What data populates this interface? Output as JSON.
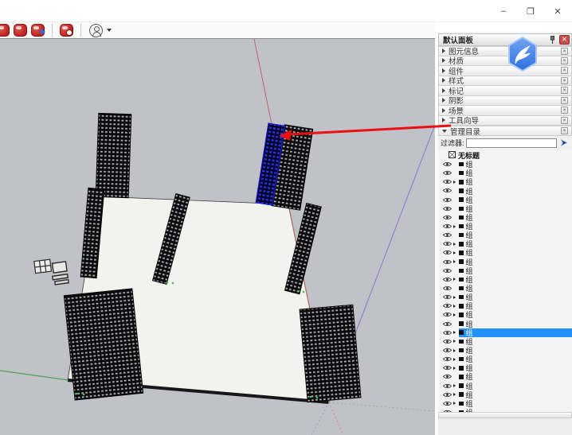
{
  "window": {
    "controls": {
      "minimize": "–",
      "maximize": "❐",
      "close": "✕"
    }
  },
  "toolbar": {
    "icons": [
      {
        "name": "plugin-red-icon-1"
      },
      {
        "name": "plugin-red-icon-2"
      },
      {
        "name": "plugin-export-icon"
      },
      {
        "name": "plugin-tag-icon"
      },
      {
        "name": "account-avatar"
      }
    ]
  },
  "panel": {
    "title": "默认面板",
    "sections": [
      {
        "label": "图元信息"
      },
      {
        "label": "材质"
      },
      {
        "label": "组件"
      },
      {
        "label": "样式"
      },
      {
        "label": "标记"
      },
      {
        "label": "阴影"
      },
      {
        "label": "场景"
      },
      {
        "label": "工具向导"
      }
    ],
    "close_glyph": "✕",
    "section_close_glyph": "×",
    "outliner": {
      "label": "管理目录",
      "filter_label": "过滤器:",
      "filter_value": "",
      "root_label": "无标题",
      "group_label": "组",
      "rows": [
        {
          "arrow": false,
          "selected": false
        },
        {
          "arrow": false,
          "selected": false
        },
        {
          "arrow": true,
          "selected": false
        },
        {
          "arrow": false,
          "selected": false
        },
        {
          "arrow": false,
          "selected": false
        },
        {
          "arrow": false,
          "selected": false
        },
        {
          "arrow": false,
          "selected": false
        },
        {
          "arrow": true,
          "selected": false
        },
        {
          "arrow": false,
          "selected": false
        },
        {
          "arrow": true,
          "selected": false
        },
        {
          "arrow": true,
          "selected": false
        },
        {
          "arrow": true,
          "selected": false
        },
        {
          "arrow": false,
          "selected": false
        },
        {
          "arrow": true,
          "selected": false
        },
        {
          "arrow": false,
          "selected": false
        },
        {
          "arrow": true,
          "selected": false
        },
        {
          "arrow": true,
          "selected": false
        },
        {
          "arrow": true,
          "selected": false
        },
        {
          "arrow": false,
          "selected": false
        },
        {
          "arrow": true,
          "selected": true
        },
        {
          "arrow": true,
          "selected": false
        },
        {
          "arrow": true,
          "selected": false
        },
        {
          "arrow": true,
          "selected": false
        },
        {
          "arrow": true,
          "selected": false
        },
        {
          "arrow": false,
          "selected": false
        },
        {
          "arrow": true,
          "selected": false
        },
        {
          "arrow": true,
          "selected": false
        },
        {
          "arrow": true,
          "selected": false
        },
        {
          "arrow": false,
          "selected": false
        }
      ]
    }
  },
  "colors": {
    "selection_blue": "#2191fb",
    "geometry_selected_blue": "#2330ee",
    "annotation_red": "#e81010",
    "axis_red": "#b76868",
    "axis_green": "#4f9e4f",
    "axis_blue": "#8289cc",
    "viewport_bg": "#c1c2c8",
    "slab_face": "#f2f2ef",
    "panel_close_red": "#c75050",
    "thunder_blue": "#3d7ee8"
  }
}
